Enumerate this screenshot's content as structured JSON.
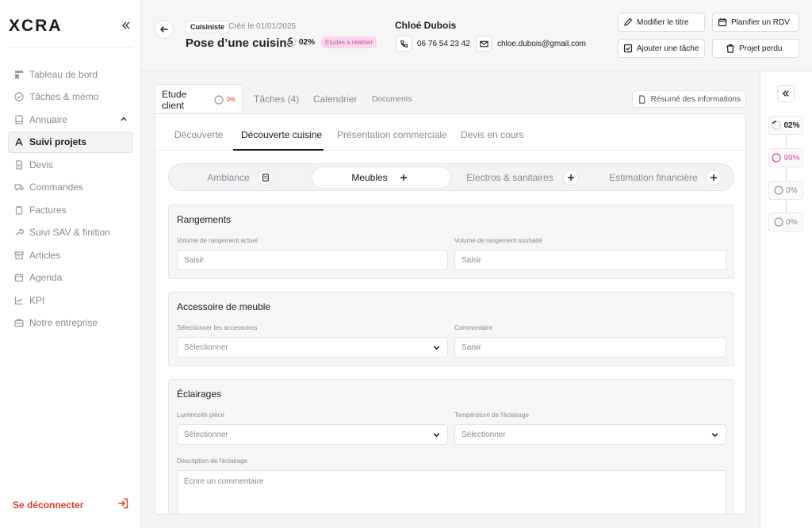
{
  "sidebar": {
    "logo": "XCRA",
    "items": [
      {
        "label": "Tableau de bord",
        "icon": "dashboard-icon"
      },
      {
        "label": "Tâches & mémo",
        "icon": "check-circle-icon"
      },
      {
        "label": "Annuaire",
        "icon": "book-icon"
      },
      {
        "label": "Suivi projets",
        "icon": "user-icon"
      },
      {
        "label": "Devis",
        "icon": "document-icon"
      },
      {
        "label": "Commandes",
        "icon": "truck-icon"
      },
      {
        "label": "Factures",
        "icon": "clipboard-icon"
      },
      {
        "label": "Suivi SAV & finition",
        "icon": "wrench-icon"
      },
      {
        "label": "Articles",
        "icon": "archive-icon"
      },
      {
        "label": "Agenda",
        "icon": "calendar-icon"
      },
      {
        "label": "KPI",
        "icon": "chart-icon"
      },
      {
        "label": "Notre entreprise",
        "icon": "briefcase-icon"
      }
    ],
    "logout": "Se déconnecter"
  },
  "header": {
    "role": "Cuisiniste",
    "created": "Créé le 01/01/2025",
    "title": "Pose d’une cuisine",
    "progress": "02%",
    "status": "Etudes à réaliser",
    "client_name": "Chloé Dubois",
    "phone": "06 76 54 23 42",
    "email": "chloe.dubois@gmail.com",
    "buttons": {
      "edit_title": "Modifier le titre",
      "plan_meeting": "Planifier un RDV",
      "add_task": "Ajouter une tâche",
      "lost_project": "Projet perdu"
    }
  },
  "main_tabs": {
    "etude": "Etude client",
    "etude_pct": "0%",
    "taches": "Tâches (4)",
    "calendrier": "Calendrier",
    "documents": "Documents",
    "resume": "Résumé des informations"
  },
  "subtabs": [
    "Découverte",
    "Découverte cuisine",
    "Présentation commerciale",
    "Devis en cours"
  ],
  "segments": [
    "Ambiance",
    "Meubles",
    "Electros & sanitaires",
    "Estimation financière"
  ],
  "sections": {
    "rangements": {
      "title": "Rangements",
      "label1": "Volume de rangement actuel",
      "placeholder1": "Saisir",
      "label2": "Volume de rangement souhaité",
      "placeholder2": "Saisir"
    },
    "accessoire": {
      "title": "Accessoire de meuble",
      "label1": "Sélectionner les accessoires",
      "value1": "Sélectionner",
      "label2": "Commentaire",
      "placeholder2": "Saisir"
    },
    "eclairages": {
      "title": "Éclairages",
      "label1": "Luminosité pièce",
      "value1": "Sélectionner",
      "label2": "Température de l'éclairage",
      "value2": "Sélectionner",
      "label3": "Description de l'éclairage",
      "placeholder3": "Écrire un commentaire"
    }
  },
  "right_panel": {
    "steps": [
      {
        "value": "02%",
        "color": "#1b1b1f"
      },
      {
        "value": "99%",
        "color": "#d2529f"
      },
      {
        "value": "0%",
        "color": "#8a8a92"
      },
      {
        "value": "0%",
        "color": "#8a8a92"
      }
    ]
  }
}
